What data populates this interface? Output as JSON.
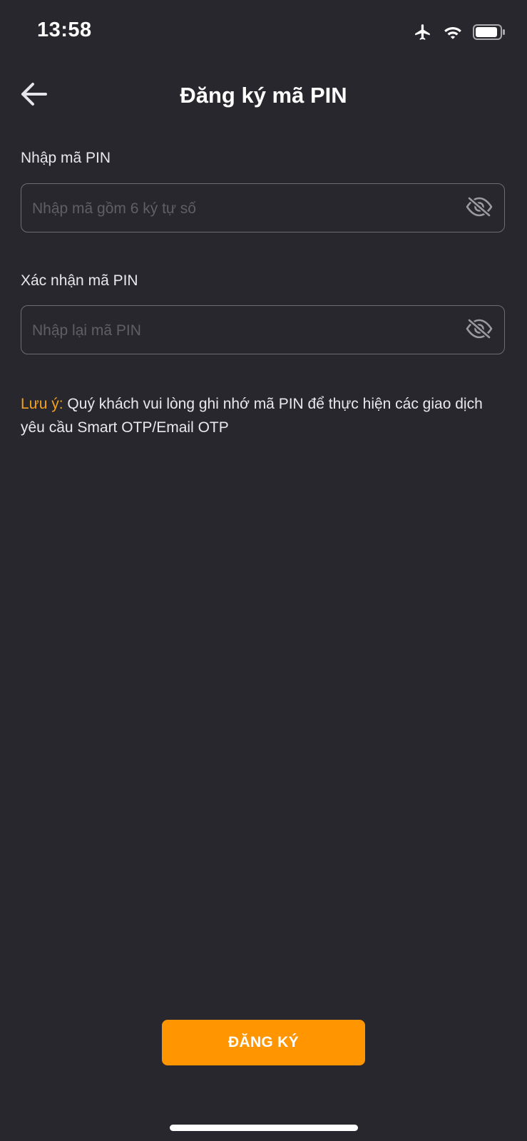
{
  "status_bar": {
    "time": "13:58",
    "icons": [
      "airplane-icon",
      "wifi-icon",
      "battery-icon"
    ]
  },
  "header": {
    "title": "Đăng ký mã PIN",
    "back_icon": "arrow-left-icon"
  },
  "form": {
    "pin": {
      "label": "Nhập mã PIN",
      "placeholder": "Nhập mã gồm 6 ký tự số",
      "value": "",
      "toggle_icon": "eye-slash-icon"
    },
    "confirm_pin": {
      "label": "Xác nhận mã PIN",
      "placeholder": "Nhập lại mã PIN",
      "value": "",
      "toggle_icon": "eye-slash-icon"
    }
  },
  "note": {
    "prefix": "Lưu ý:",
    "text": " Quý khách vui lòng ghi nhớ mã PIN để thực hiện các giao dịch yêu cầu Smart OTP/Email OTP"
  },
  "actions": {
    "register_label": "ĐĂNG KÝ"
  },
  "colors": {
    "background": "#28272d",
    "accent": "#ff9500",
    "note_prefix": "#f7a21b",
    "border": "#6d6d73"
  }
}
